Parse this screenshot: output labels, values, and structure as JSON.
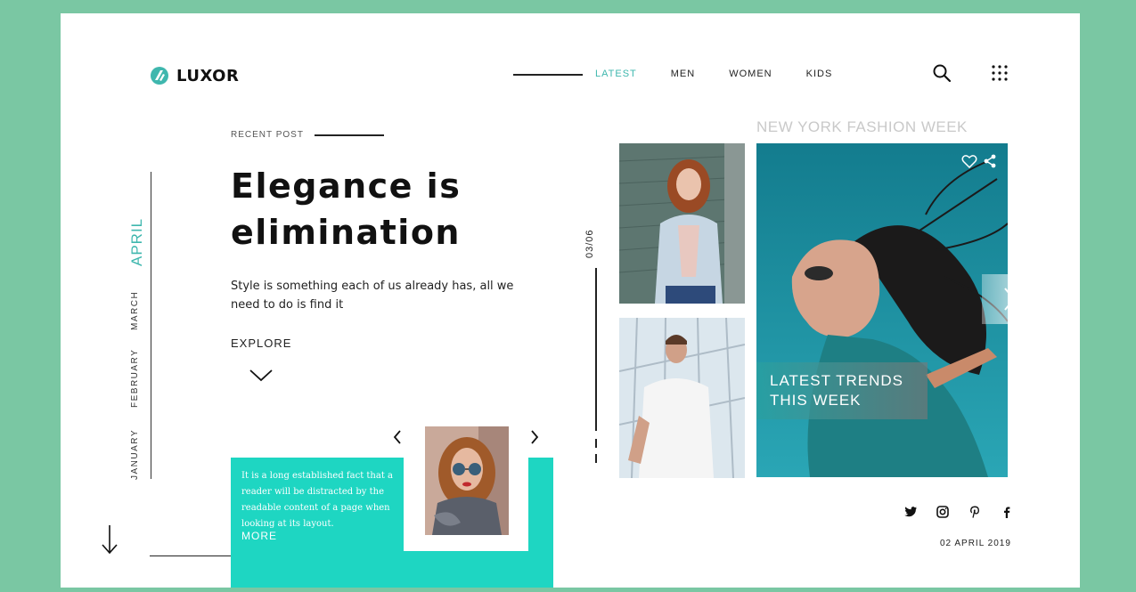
{
  "brand": {
    "name": "LUXOR"
  },
  "nav": {
    "items": [
      {
        "label": "LATEST",
        "active": true
      },
      {
        "label": "MEN",
        "active": false
      },
      {
        "label": "WOMEN",
        "active": false
      },
      {
        "label": "KIDS",
        "active": false
      }
    ]
  },
  "months": [
    "APRIL",
    "MARCH",
    "FEBRUARY",
    "JANUARY"
  ],
  "post": {
    "tag": "RECENT POST",
    "title_line1": "Elegance is",
    "title_line2": "elimination",
    "subtitle": "Style is something each of us already has, all we need to do is find it",
    "explore": "EXPLORE"
  },
  "teaser": {
    "text": "It is a long established fact that a reader will be distracted by the readable content of a page when looking at its layout.",
    "more": "MORE"
  },
  "gallery": {
    "counter": "03/06"
  },
  "feature": {
    "heading": "NEW YORK FASHION WEEK",
    "trend_line1": "LATEST TRENDS",
    "trend_line2": "THIS WEEK"
  },
  "footer": {
    "date": "02 APRIL 2019"
  },
  "colors": {
    "accent": "#3fb7ae",
    "teal_box": "#1ed6c2",
    "background": "#7ac7a3"
  },
  "icons": [
    "search-icon",
    "grid-menu-icon",
    "heart-icon",
    "share-icon",
    "twitter-icon",
    "instagram-icon",
    "pinterest-icon",
    "facebook-icon",
    "chevron-down-icon",
    "arrow-down-icon",
    "chevron-left-icon",
    "chevron-right-icon"
  ]
}
